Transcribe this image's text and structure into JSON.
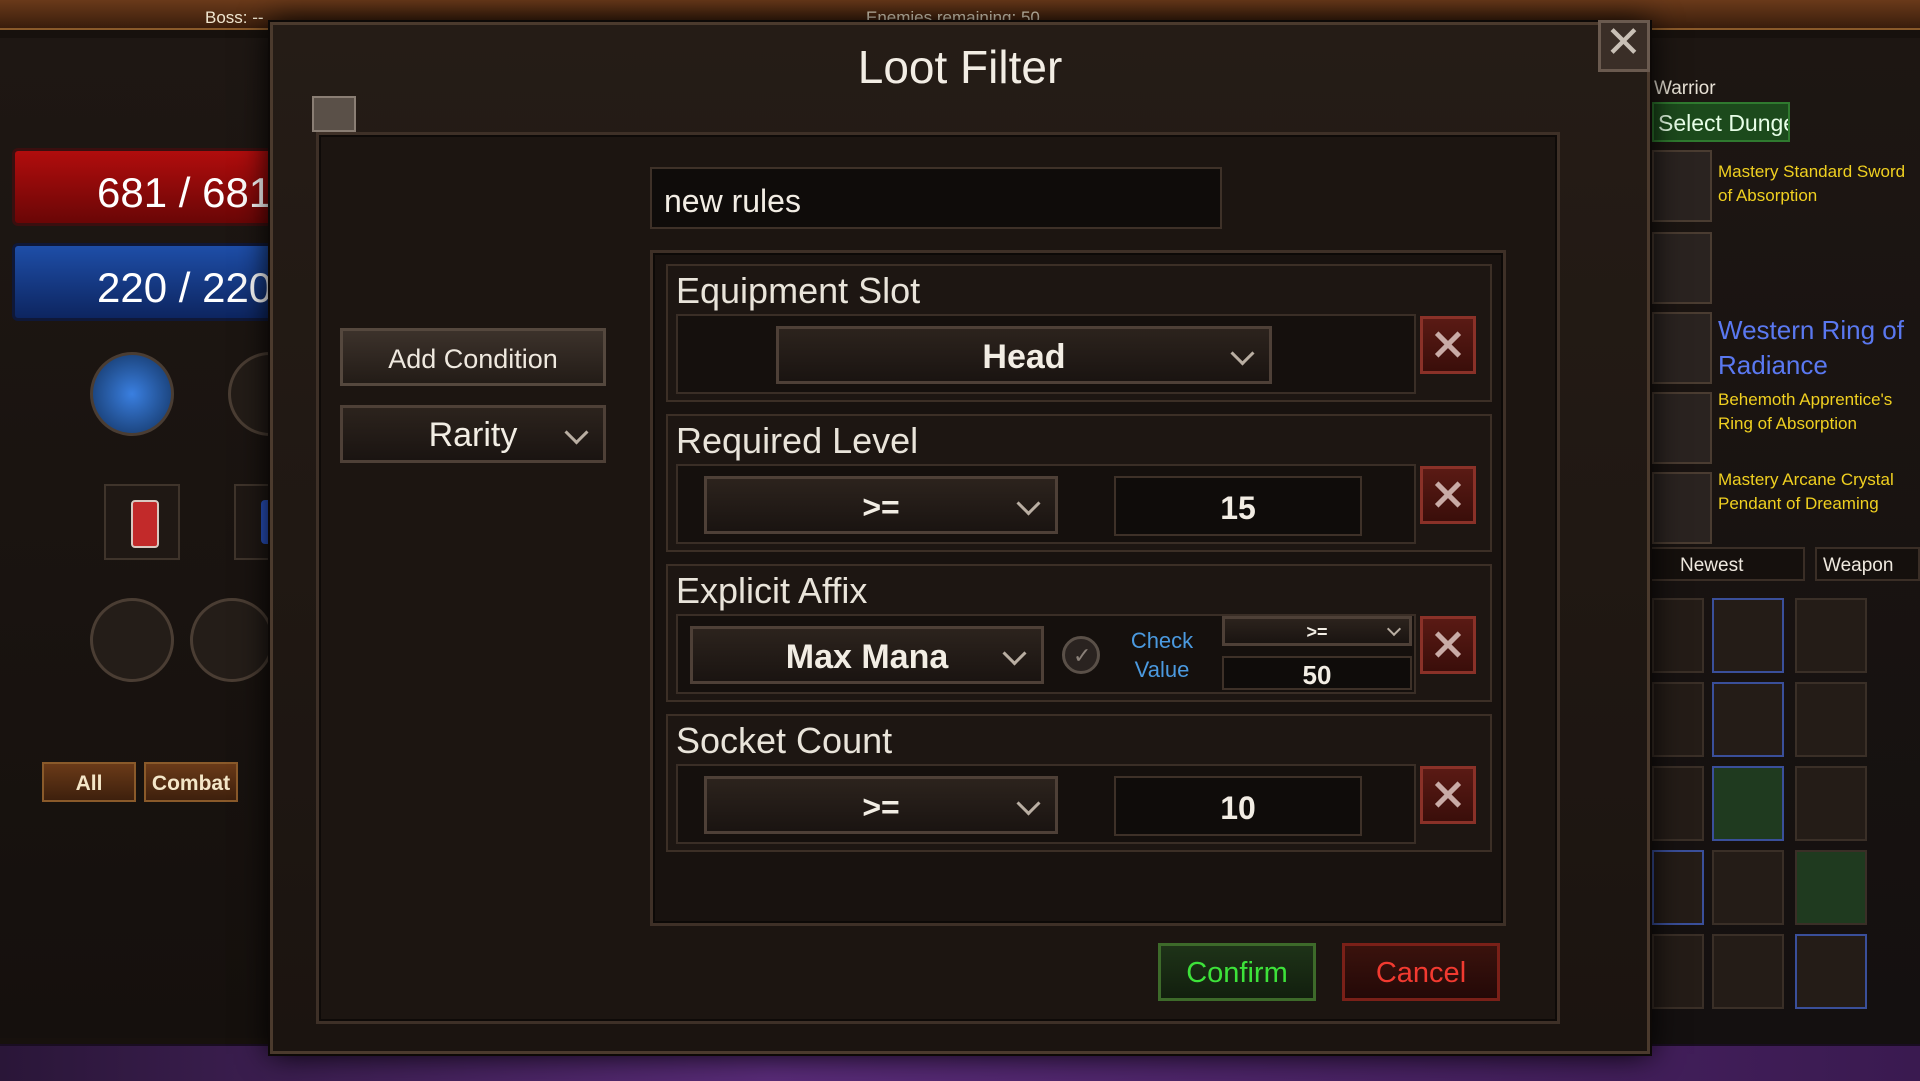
{
  "hud": {
    "boss_label": "Boss: --",
    "enemies_label": "Enemies remaining: 50",
    "hp_text": "681 / 681",
    "mp_text": "220 / 220",
    "tabs": [
      "All",
      "Combat"
    ]
  },
  "right_panel": {
    "class_text": "Warrior",
    "dungeon_button": "Select Dungeon",
    "items": [
      {
        "name": "Mastery Standard Sword of Absorption",
        "color": "#f0d020"
      },
      {
        "name": "Western Ring of Radiance",
        "color": "#5a78f0"
      },
      {
        "name": "Behemoth Apprentice's Ring of Absorption",
        "color": "#f0d020"
      },
      {
        "name": "Mastery Arcane Crystal Pendant of Dreaming",
        "color": "#f0d020"
      }
    ],
    "sort_select": "Newest",
    "type_select": "Weapon"
  },
  "dialog": {
    "title": "Loot Filter",
    "rule_name": "new rules",
    "add_condition_label": "Add Condition",
    "condition_type_select": "Rarity",
    "conditions": [
      {
        "title": "Equipment Slot",
        "select": "Head"
      },
      {
        "title": "Required Level",
        "operator": ">=",
        "value": "15"
      },
      {
        "title": "Explicit Affix",
        "select": "Max Mana",
        "check_value_label": "Check Value",
        "operator": ">=",
        "value": "50"
      },
      {
        "title": "Socket Count",
        "operator": ">=",
        "value": "10"
      }
    ],
    "confirm_label": "Confirm",
    "cancel_label": "Cancel"
  }
}
